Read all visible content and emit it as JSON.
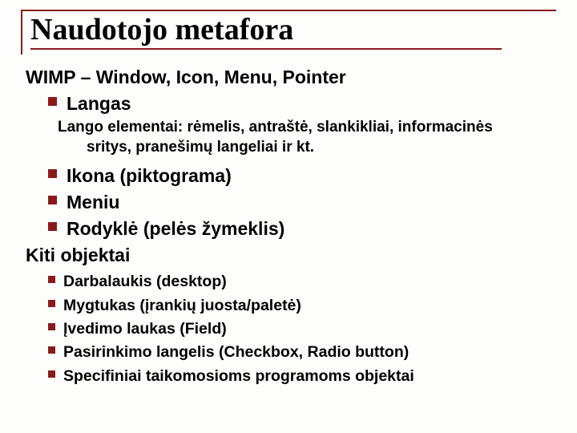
{
  "title": "Naudotojo metafora",
  "lead": "WIMP – Window, Icon, Menu, Pointer",
  "primary": [
    {
      "label": "Langas"
    }
  ],
  "primary_sub": {
    "line1": "Lango elementai: rėmelis, antraštė, slankikliai, informacinės",
    "line2": "sritys, pranešimų langeliai ir kt."
  },
  "primary_rest": [
    {
      "label": "Ikona (piktograma)"
    },
    {
      "label": "Meniu"
    },
    {
      "label": "Rodyklė (pelės žymeklis)"
    }
  ],
  "secondary_heading": "Kiti objektai",
  "secondary": [
    {
      "label": "Darbalaukis (desktop)"
    },
    {
      "label": "Mygtukas (įrankių juosta/paletė)"
    },
    {
      "label": "Įvedimo laukas (Field)"
    },
    {
      "label": "Pasirinkimo langelis (Checkbox, Radio button)"
    },
    {
      "label": "Specifiniai taikomosioms programoms objektai"
    }
  ]
}
